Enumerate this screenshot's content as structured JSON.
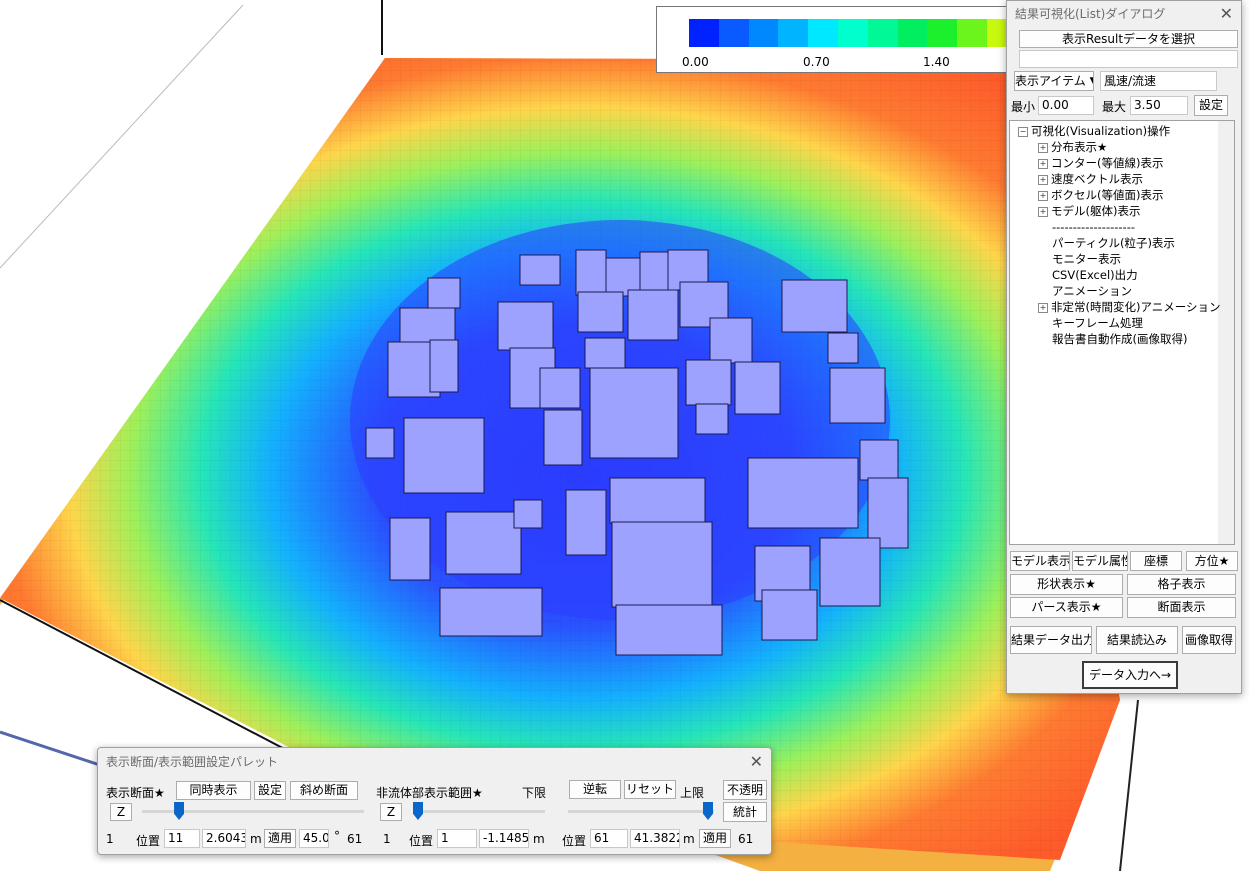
{
  "legend": {
    "colors": [
      "#0022ff",
      "#0a5bff",
      "#0088ff",
      "#00b4ff",
      "#00e8ff",
      "#00ffcc",
      "#00f896",
      "#00ee60",
      "#1cef2c",
      "#6cf51a",
      "#c8f80e"
    ],
    "labels": [
      "0.00",
      "0.70",
      "1.40"
    ]
  },
  "result_dialog": {
    "title": "結果可視化(List)ダイアログ",
    "select_button": "表示Resultデータを選択",
    "selected_data": "",
    "item_dropdown": "表示アイテム ▼",
    "item_value": "風速/流速",
    "min_label": "最小",
    "min_value": "0.00",
    "max_label": "最大",
    "max_value": "3.50",
    "set_button": "設定",
    "tree": {
      "root": "可視化(Visualization)操作",
      "items": [
        {
          "label": "分布表示★",
          "expandable": true
        },
        {
          "label": "コンター(等値線)表示",
          "expandable": true
        },
        {
          "label": "速度ベクトル表示",
          "expandable": true
        },
        {
          "label": "ボクセル(等値面)表示",
          "expandable": true
        },
        {
          "label": "モデル(躯体)表示",
          "expandable": true
        },
        {
          "label": "--------------------",
          "expandable": false
        },
        {
          "label": "パーティクル(粒子)表示",
          "expandable": false
        },
        {
          "label": "モニター表示",
          "expandable": false
        },
        {
          "label": "CSV(Excel)出力",
          "expandable": false
        },
        {
          "label": "アニメーション",
          "expandable": false
        },
        {
          "label": "非定常(時間変化)アニメーション",
          "expandable": true
        },
        {
          "label": "キーフレーム処理",
          "expandable": false
        },
        {
          "label": "報告書自動作成(画像取得)",
          "expandable": false
        }
      ]
    },
    "buttons": {
      "model_display": "モデル表示",
      "model_attr": "モデル属性",
      "coords": "座標",
      "direction": "方位★",
      "shape_display": "形状表示★",
      "grid_display": "格子表示",
      "perspective": "パース表示★",
      "section_display": "断面表示",
      "export_results": "結果データ出力",
      "load_results": "結果読込み",
      "capture_image": "画像取得",
      "to_data_input": "データ入力へ→"
    }
  },
  "palette": {
    "title": "表示断面/表示範囲設定パレット",
    "section_label": "表示断面★",
    "simultaneous_button": "同時表示",
    "set_button": "設定",
    "oblique_button": "斜め断面",
    "axis_left": "Z",
    "left_min": "1",
    "position_label": "位置",
    "position_value": "11",
    "position_coord": "2.60434",
    "unit_m": "m",
    "apply_button": "適用",
    "angle_value": "45.0",
    "degree": "°",
    "left_max": "61",
    "left_slider_fraction": 0.167,
    "range_label": "非流体部表示範囲★",
    "lower_label": "下限",
    "reverse_button": "逆転",
    "reset_button": "リセット",
    "upper_label": "上限",
    "opaque_button": "不透明",
    "axis_mid": "Z",
    "stats_button": "統計",
    "mid_min": "1",
    "lower_position_label": "位置",
    "lower_position_value": "1",
    "lower_coord": "-1.14850",
    "lower_unit": "m",
    "lower_slider_fraction": 0.0,
    "upper_position_label": "位置",
    "upper_position_value": "61",
    "upper_coord": "41.38222",
    "upper_unit": "m",
    "upper_apply_button": "適用",
    "upper_max": "61",
    "upper_slider_fraction": 1.0
  }
}
